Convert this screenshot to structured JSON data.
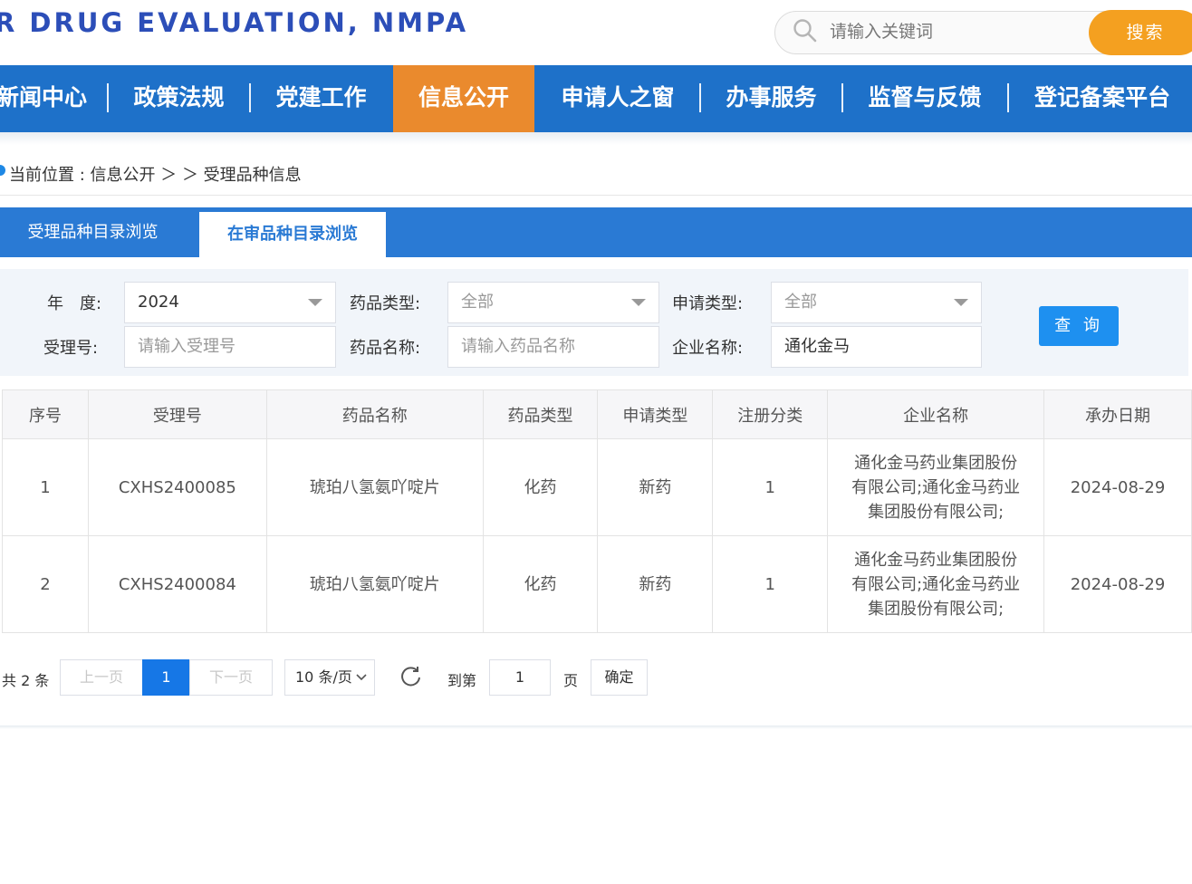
{
  "header": {
    "site_title": "R DRUG EVALUATION, NMPA",
    "search_placeholder": "请输入关键词",
    "search_button": "搜索"
  },
  "nav": {
    "items": [
      {
        "label": "新闻中心",
        "active": false
      },
      {
        "label": "政策法规",
        "active": false
      },
      {
        "label": "党建工作",
        "active": false
      },
      {
        "label": "信息公开",
        "active": true
      },
      {
        "label": "申请人之窗",
        "active": false
      },
      {
        "label": "办事服务",
        "active": false
      },
      {
        "label": "监督与反馈",
        "active": false
      },
      {
        "label": "登记备案平台",
        "active": false
      }
    ]
  },
  "breadcrumb": {
    "text": "当前位置 : 信息公开 ＞ ＞ 受理品种信息"
  },
  "tabs": [
    {
      "label": "受理品种目录浏览",
      "active": false
    },
    {
      "label": "在审品种目录浏览",
      "active": true
    }
  ],
  "filters": {
    "year_label": "年　度:",
    "year_value": "2024",
    "drug_type_label": "药品类型:",
    "drug_type_value": "全部",
    "apply_type_label": "申请类型:",
    "apply_type_value": "全部",
    "accept_no_label": "受理号:",
    "accept_no_placeholder": "请输入受理号",
    "drug_name_label": "药品名称:",
    "drug_name_placeholder": "请输入药品名称",
    "company_label": "企业名称:",
    "company_value": "通化金马",
    "query_button": "查 询"
  },
  "table": {
    "headers": [
      "序号",
      "受理号",
      "药品名称",
      "药品类型",
      "申请类型",
      "注册分类",
      "企业名称",
      "承办日期"
    ],
    "rows": [
      [
        "1",
        "CXHS2400085",
        "琥珀八氢氨吖啶片",
        "化药",
        "新药",
        "1",
        "通化金马药业集团股份有限公司;通化金马药业集团股份有限公司;",
        "2024-08-29"
      ],
      [
        "2",
        "CXHS2400084",
        "琥珀八氢氨吖啶片",
        "化药",
        "新药",
        "1",
        "通化金马药业集团股份有限公司;通化金马药业集团股份有限公司;",
        "2024-08-29"
      ]
    ]
  },
  "pagination": {
    "total": "共 2 条",
    "prev": "上一页",
    "current_page": "1",
    "next": "下一页",
    "page_size": "10 条/页",
    "goto_label": "到第",
    "goto_value": "1",
    "page_unit": "页",
    "confirm": "确定"
  },
  "colors": {
    "nav_bg": "#1e71c9",
    "nav_active": "#ea8a2d",
    "search_btn": "#f4a020",
    "tab_bar": "#2a7ad4",
    "query_btn": "#1e90f0",
    "page_current": "#1677e6"
  }
}
